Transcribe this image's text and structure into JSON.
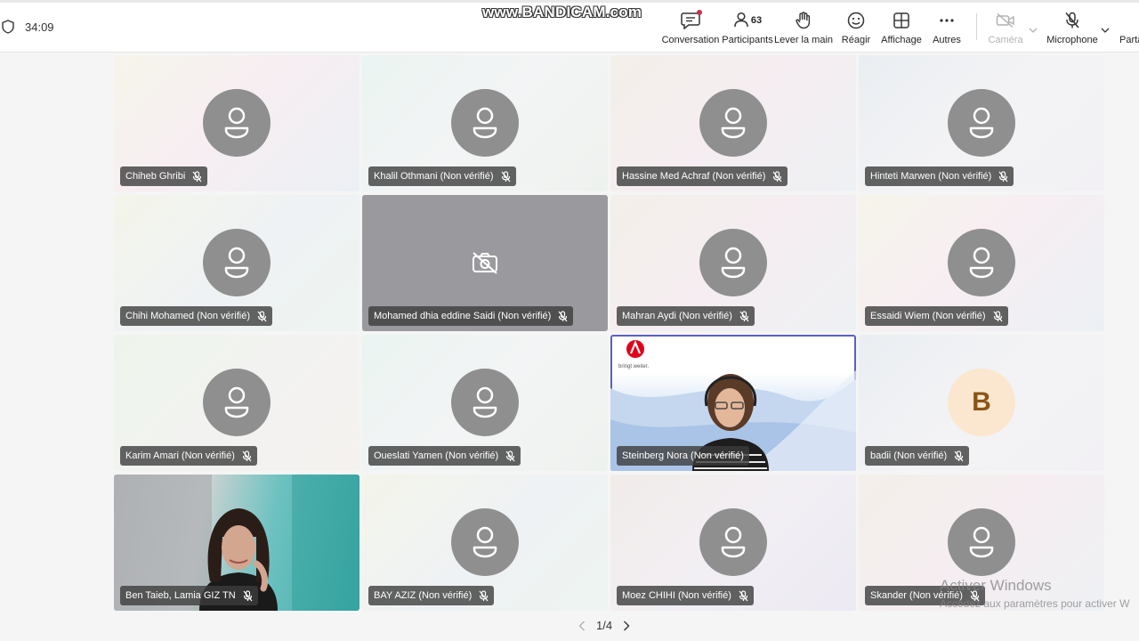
{
  "header": {
    "timer": "34:09",
    "watermark": "www.BANDICAM.com",
    "buttons": {
      "conversation": "Conversation",
      "participants": "Participants",
      "participants_count": "63",
      "raise_hand": "Lever la main",
      "react": "Réagir",
      "view": "Affichage",
      "more": "Autres",
      "camera": "Caméra",
      "microphone": "Microphone",
      "share": "Parta"
    }
  },
  "tiles": [
    {
      "name": "Chiheb Ghribi"
    },
    {
      "name": "Khalil Othmani (Non vérifié)"
    },
    {
      "name": "Hassine Med Achraf (Non vérifié)"
    },
    {
      "name": "Hinteti Marwen (Non vérifié)"
    },
    {
      "name": "Chihi Mohamed (Non vérifié)"
    },
    {
      "name": "Mohamed dhia eddine Saidi (Non vérifié)"
    },
    {
      "name": "Mahran Aydi (Non vérifié)"
    },
    {
      "name": "Essaidi Wiem (Non vérifié)"
    },
    {
      "name": "Karim Amari (Non vérifié)"
    },
    {
      "name": "Oueslati Yamen (Non vérifié)"
    },
    {
      "name": "Steinberg Nora (Non vérifié)",
      "slogan": "bringt weiter."
    },
    {
      "name": "badii (Non vérifié)",
      "initial": "B"
    },
    {
      "name": "Ben Taieb, Lamia GIZ TN"
    },
    {
      "name": "BAY AZIZ (Non vérifié)"
    },
    {
      "name": "Moez CHIHI (Non vérifié)"
    },
    {
      "name": "Skander (Non vérifié)"
    }
  ],
  "pager": {
    "label": "1/4"
  },
  "activation": {
    "title": "Activer Windows",
    "subtitle": "Accédez aux paramètres pour activer W"
  },
  "colors": {
    "accent": "#5b5fc7",
    "notification": "#c4314b",
    "avatar_gray": "#8f8f8f"
  }
}
